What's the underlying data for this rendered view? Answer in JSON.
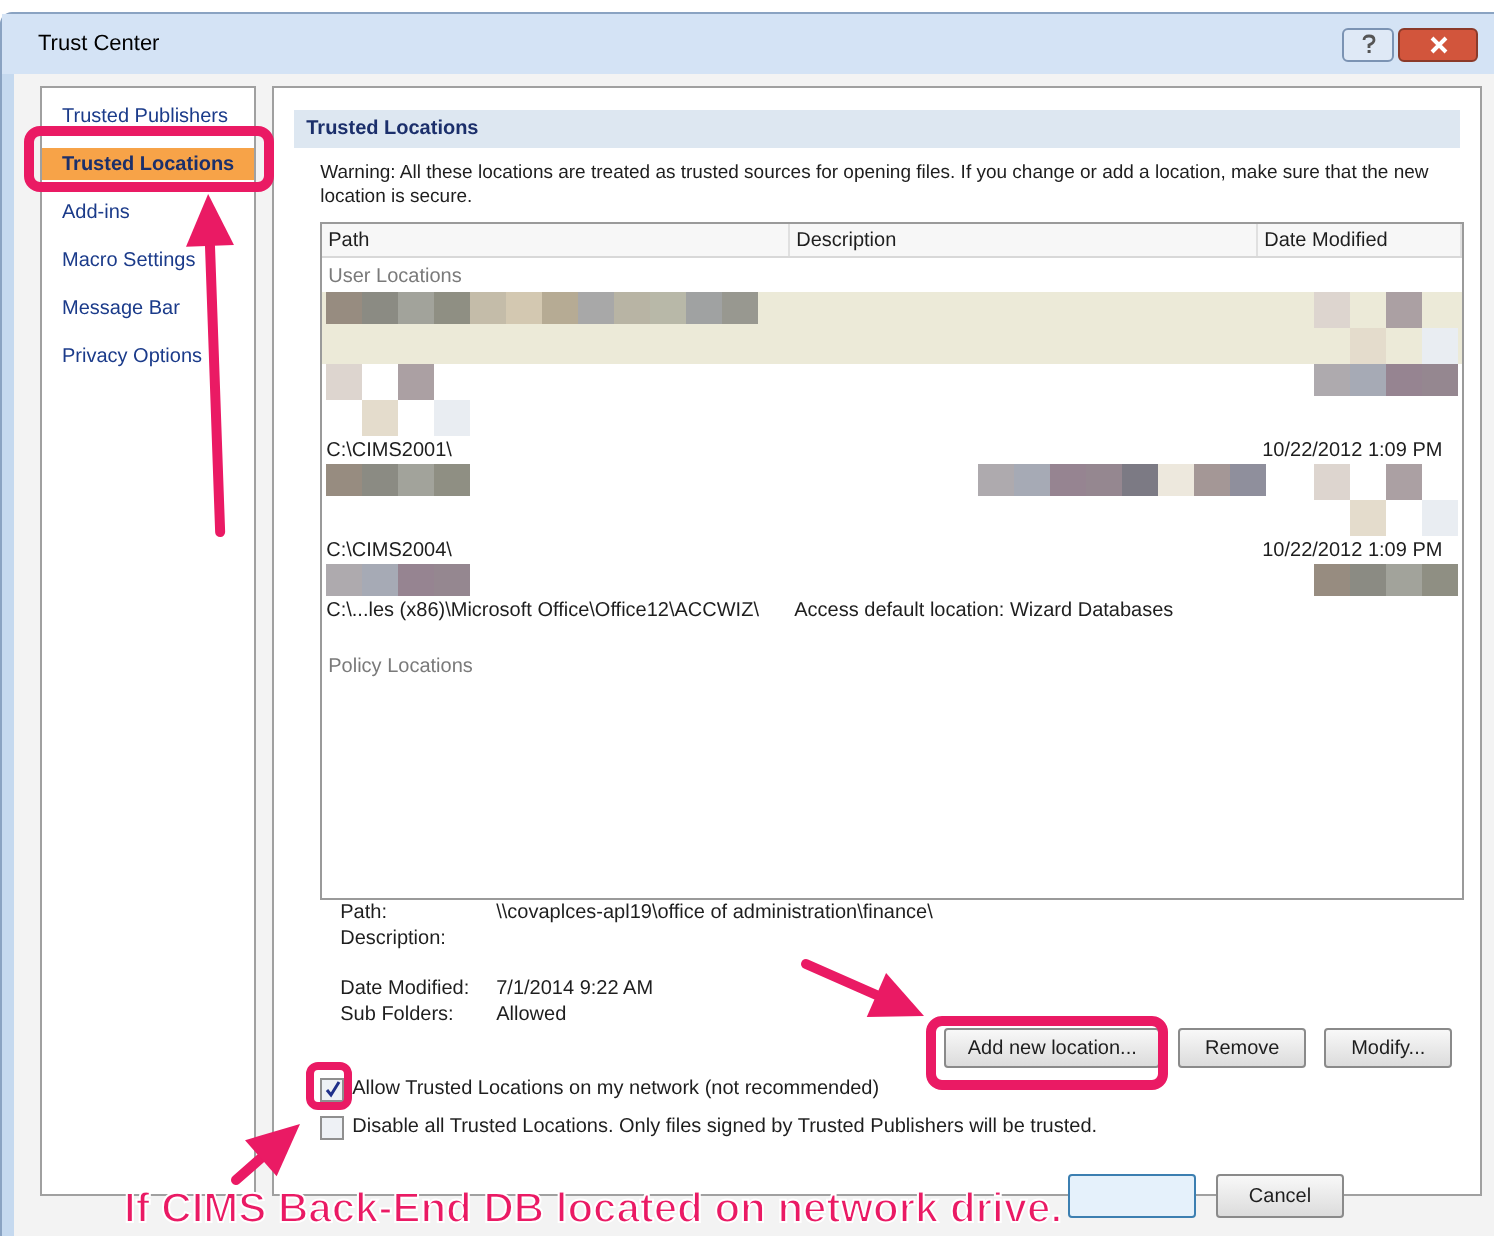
{
  "window": {
    "title": "Trust Center"
  },
  "sidebar": {
    "items": [
      {
        "label": "Trusted Publishers",
        "selected": false
      },
      {
        "label": "Trusted Locations",
        "selected": true
      },
      {
        "label": "Add-ins",
        "selected": false
      },
      {
        "label": "Macro Settings",
        "selected": false
      },
      {
        "label": "Message Bar",
        "selected": false
      },
      {
        "label": "Privacy Options",
        "selected": false
      }
    ]
  },
  "section_title": "Trusted Locations",
  "warning": "Warning: All these locations are treated as trusted sources for opening files.  If you change or add a location, make sure that the new location is secure.",
  "table": {
    "columns": [
      "Path",
      "Description",
      "Date Modified"
    ],
    "groups": [
      {
        "label": "User Locations",
        "rows": [
          {
            "kind": "redacted",
            "selected": true
          },
          {
            "kind": "redacted",
            "selected": false
          },
          {
            "kind": "location",
            "path": "C:\\CIMS2001\\",
            "date": "10/22/2012 1:09 PM",
            "selected": false
          },
          {
            "kind": "redacted",
            "selected": false
          },
          {
            "kind": "location",
            "path": "C:\\CIMS2004\\",
            "date": "10/22/2012 1:09 PM",
            "selected": false
          },
          {
            "kind": "redacted",
            "selected": false
          },
          {
            "kind": "location",
            "path": "C:\\...les (x86)\\Microsoft Office\\Office12\\ACCWIZ\\",
            "description": "Access default location: Wizard Databases",
            "selected": false
          }
        ]
      },
      {
        "label": "Policy Locations"
      }
    ]
  },
  "details": [
    {
      "label": "Path:",
      "value": "\\\\covaplces-apl19\\office of administration\\finance\\"
    },
    {
      "label": "Description:"
    },
    {
      "label": "Date Modified:",
      "value": "7/1/2014 9:22 AM"
    },
    {
      "label": "Sub Folders:",
      "value": "Allowed"
    }
  ],
  "buttons": [
    "Add new location...",
    "Remove",
    "Modify..."
  ],
  "checkboxes": [
    {
      "label": "Allow Trusted Locations on my network (not recommended)",
      "checked": true
    },
    {
      "label": "Disable all Trusted Locations. Only files signed by Trusted Publishers will be trusted.",
      "checked": false
    }
  ],
  "footer_buttons": [
    "Cancel"
  ],
  "annotation": "If CIMS Back-End DB located on network drive."
}
